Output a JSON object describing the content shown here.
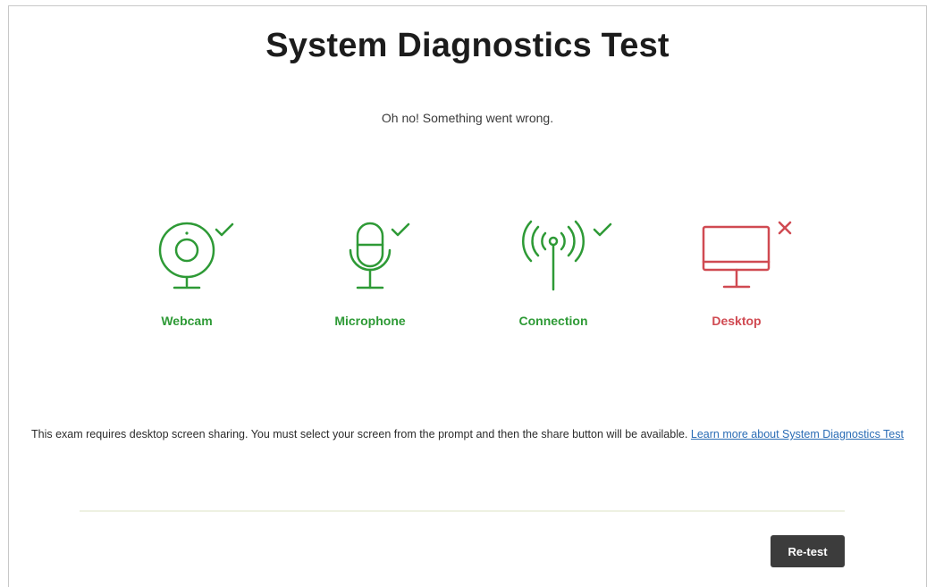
{
  "page": {
    "title": "System Diagnostics Test",
    "status_message": "Oh no! Something went wrong."
  },
  "checks": [
    {
      "label": "Webcam",
      "icon": "webcam-icon",
      "status": "passed",
      "status_icon": "checkmark-icon"
    },
    {
      "label": "Microphone",
      "icon": "microphone-icon",
      "status": "passed",
      "status_icon": "checkmark-icon"
    },
    {
      "label": "Connection",
      "icon": "antenna-icon",
      "status": "passed",
      "status_icon": "checkmark-icon"
    },
    {
      "label": "Desktop",
      "icon": "monitor-icon",
      "status": "failed",
      "status_icon": "x-icon"
    }
  ],
  "info": {
    "text": "This exam requires desktop screen sharing. You must select your screen from the prompt and then the share button will be available.",
    "link_text": "Learn more about System Diagnostics Test"
  },
  "actions": {
    "retest_label": "Re-test"
  },
  "colors": {
    "success": "#2e9a36",
    "failure": "#d04a52",
    "link": "#2a6cb5",
    "button_bg": "#3c3c3c"
  }
}
